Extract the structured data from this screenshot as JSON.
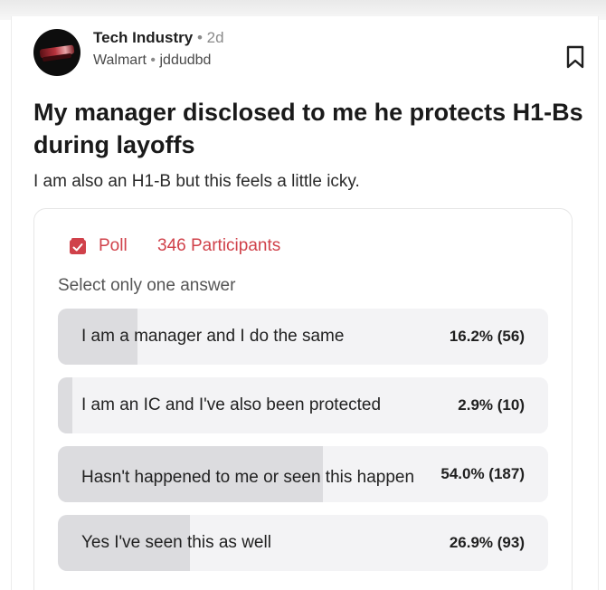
{
  "post": {
    "community": "Tech Industry",
    "separator": "•",
    "age": "2d",
    "company": "Walmart",
    "author": "jddudbd",
    "title": "My manager disclosed to me he protects H1-Bs during layoffs",
    "body": "I am also an H1-B but this feels a little icky.",
    "icons": {
      "avatar": "knife-logo",
      "bookmark": "bookmark-icon",
      "poll": "poll-icon"
    }
  },
  "poll": {
    "label": "Poll",
    "participants": "346 Participants",
    "hint": "Select only one answer",
    "accent": "#d0414a",
    "options": [
      {
        "label": "I am a manager and I do the same",
        "result": "16.2% (56)",
        "share": 16.2
      },
      {
        "label": "I am an IC and I've also been protected",
        "result": "2.9% (10)",
        "share": 2.9
      },
      {
        "label": "Hasn't happened to me or seen this happen",
        "result": "54.0% (187)",
        "share": 54.0
      },
      {
        "label": "Yes I've seen this as well",
        "result": "26.9% (93)",
        "share": 26.9
      }
    ]
  }
}
